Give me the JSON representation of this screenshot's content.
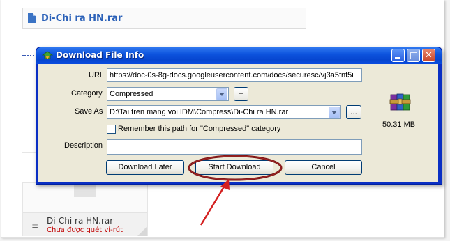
{
  "background_page": {
    "file_header": "Di-Chi ra HN.rar",
    "preview": {
      "file_name": "Di-Chi ra HN.rar",
      "status": "Chưa được quét vi-rút"
    }
  },
  "dialog": {
    "title": "Download File Info",
    "fields": {
      "url_label": "URL",
      "url_value": "https://doc-0s-8g-docs.googleusercontent.com/docs/securesc/vj3a5fnf5i",
      "category_label": "Category",
      "category_value": "Compressed",
      "add_category": "+",
      "save_as_label": "Save As",
      "save_as_value": "D:\\Tai tren mang voi IDM\\Compress\\Di-Chi ra HN.rar",
      "browse": "...",
      "remember_label": "Remember this path for \"Compressed\" category",
      "remember_checked": false,
      "description_label": "Description",
      "description_value": ""
    },
    "file_size": "50.31  MB",
    "buttons": {
      "download_later": "Download Later",
      "start_download": "Start Download",
      "cancel": "Cancel"
    }
  },
  "icons": {
    "title": "idm-app-icon",
    "file": "winrar-archive-icon",
    "annotation": "red-arrow"
  },
  "colors": {
    "title_bar": "#0d54de",
    "dialog_face": "#ece9d8",
    "annotation": "#b01818",
    "link_blue": "#2b61b8"
  }
}
